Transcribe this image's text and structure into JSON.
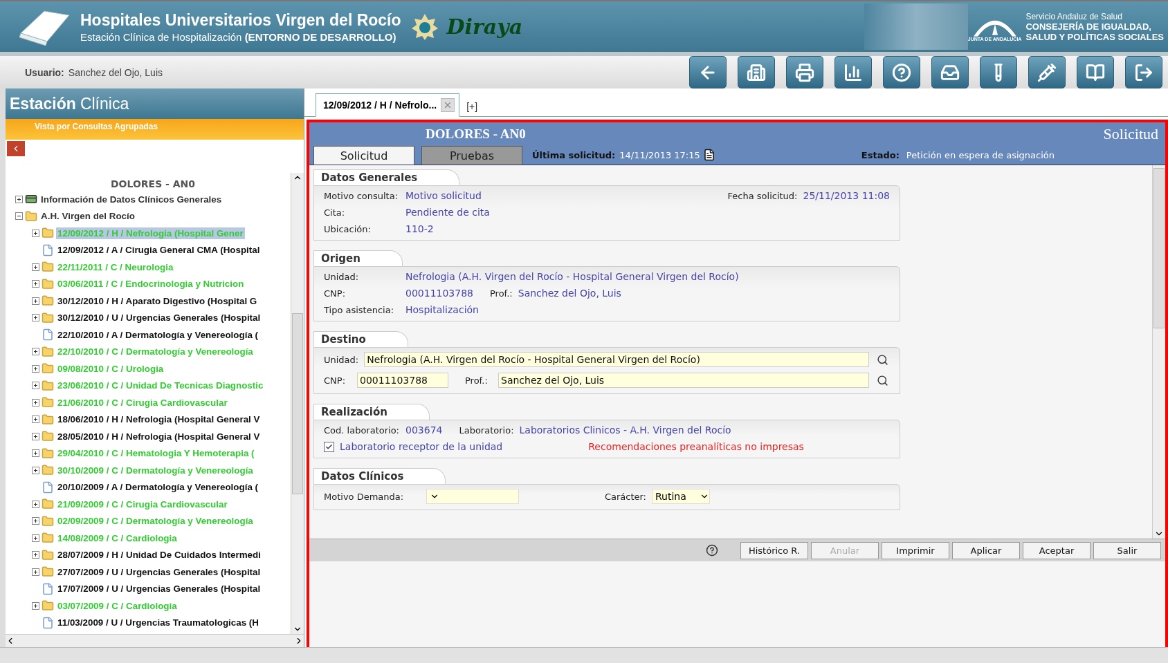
{
  "header": {
    "title": "Hospitales Universitarios Virgen del Rocío",
    "subtitle": "Estación Clínica de Hospitalización **(ENTORNO DE DESARROLLO)**",
    "brand": "Diraya",
    "agency_small": "JUNTA DE ANDALUCIA",
    "agency_service": "Servicio Andaluz de Salud",
    "agency_lines": [
      "CONSEJERÍA DE IGUALDAD,",
      "SALUD Y POLÍTICAS SOCIALES"
    ]
  },
  "user": {
    "label": "Usuario:",
    "name": "Sanchez del Ojo, Luis"
  },
  "toolbar": [
    {
      "kind": "back"
    },
    {
      "kind": "record"
    },
    {
      "kind": "scanner"
    },
    {
      "kind": "chart"
    },
    {
      "kind": "help"
    },
    {
      "kind": "tray"
    },
    {
      "kind": "tube"
    },
    {
      "kind": "syringe"
    },
    {
      "kind": "book"
    },
    {
      "kind": "exit"
    }
  ],
  "sidebar": {
    "title_bold": "Estación",
    "title_rest": "Clínica",
    "view": "Vista por Consultas Agrupadas",
    "patient": "DOLORES - AN0",
    "tree": [
      {
        "label": "Información de Datos Clínicos Generales",
        "kind": "record",
        "expanded": false,
        "color": "#333333",
        "selected": false
      },
      {
        "label": "A.H. Virgen del Rocío",
        "kind": "folder",
        "expanded": true,
        "color": "#333333",
        "selected": false,
        "children": [
          {
            "label": "12/09/2012 / H / Nefrologia (Hospital Gener",
            "kind": "folder",
            "expanded": false,
            "color": "#33cc33",
            "selected": true
          },
          {
            "label": "12/09/2012 / A / Cirugia General CMA (Hospital",
            "kind": "document",
            "color": "#111111",
            "selected": false
          },
          {
            "label": "22/11/2011 / C / Neurologia",
            "kind": "folder",
            "expanded": false,
            "color": "#33cc33",
            "selected": false
          },
          {
            "label": "03/06/2011 / C / Endocrinologia y Nutricion",
            "kind": "folder",
            "expanded": false,
            "color": "#33cc33",
            "selected": false
          },
          {
            "label": "30/12/2010 / H / Aparato Digestivo (Hospital G",
            "kind": "folder",
            "expanded": false,
            "color": "#111111",
            "selected": false
          },
          {
            "label": "30/12/2010 / U / Urgencias Generales (Hospital",
            "kind": "folder",
            "expanded": false,
            "color": "#111111",
            "selected": false
          },
          {
            "label": "22/10/2010 / A / Dermatología y Venereología (",
            "kind": "document",
            "color": "#111111",
            "selected": false
          },
          {
            "label": "22/10/2010 / C / Dermatología y Venereología",
            "kind": "folder",
            "expanded": false,
            "color": "#33cc33",
            "selected": false
          },
          {
            "label": "09/08/2010 / C / Urologia",
            "kind": "folder",
            "expanded": false,
            "color": "#33cc33",
            "selected": false
          },
          {
            "label": "23/06/2010 / C / Unidad De Tecnicas Diagnostic",
            "kind": "folder",
            "expanded": false,
            "color": "#33cc33",
            "selected": false
          },
          {
            "label": "21/06/2010 / C / Cirugia Cardiovascular",
            "kind": "folder",
            "expanded": false,
            "color": "#33cc33",
            "selected": false
          },
          {
            "label": "18/06/2010 / H / Nefrologia (Hospital General V",
            "kind": "folder",
            "expanded": false,
            "color": "#111111",
            "selected": false
          },
          {
            "label": "28/05/2010 / H / Nefrologia (Hospital General V",
            "kind": "folder",
            "expanded": false,
            "color": "#111111",
            "selected": false
          },
          {
            "label": "29/04/2010 / C / Hematologia Y Hemoterapia (",
            "kind": "folder",
            "expanded": false,
            "color": "#33cc33",
            "selected": false
          },
          {
            "label": "30/10/2009 / C / Dermatología y Venereología",
            "kind": "folder",
            "expanded": false,
            "color": "#33cc33",
            "selected": false
          },
          {
            "label": "20/10/2009 / A / Dermatología y Venereología (",
            "kind": "document",
            "color": "#111111",
            "selected": false
          },
          {
            "label": "21/09/2009 / C / Cirugia Cardiovascular",
            "kind": "folder",
            "expanded": false,
            "color": "#33cc33",
            "selected": false
          },
          {
            "label": "02/09/2009 / C / Dermatología y Venereología",
            "kind": "folder",
            "expanded": false,
            "color": "#33cc33",
            "selected": false
          },
          {
            "label": "14/08/2009 / C / Cardiologia",
            "kind": "folder",
            "expanded": false,
            "color": "#33cc33",
            "selected": false
          },
          {
            "label": "28/07/2009 / H / Unidad De Cuidados Intermedi",
            "kind": "folder",
            "expanded": false,
            "color": "#111111",
            "selected": false
          },
          {
            "label": "27/07/2009 / U / Urgencias Generales (Hospital",
            "kind": "folder",
            "expanded": false,
            "color": "#111111",
            "selected": false
          },
          {
            "label": "17/07/2009 / U / Urgencias Generales (Hospital",
            "kind": "document",
            "color": "#111111",
            "selected": false
          },
          {
            "label": "03/07/2009 / C / Cardiologia",
            "kind": "folder",
            "expanded": false,
            "color": "#33cc33",
            "selected": false
          },
          {
            "label": "11/03/2009 / U / Urgencias Traumatologicas (H",
            "kind": "document",
            "color": "#111111",
            "selected": false
          }
        ]
      }
    ]
  },
  "doc_tabs": {
    "tabs": [
      {
        "label": "12/09/2012 / H / Nefrolo...",
        "selected": true
      }
    ],
    "add": "[+]"
  },
  "form": {
    "patient": "DOLORES - AN0",
    "title": "Solicitud",
    "tabs": [
      {
        "label": "Solicitud",
        "selected": true
      },
      {
        "label": "Pruebas",
        "selected": false
      }
    ],
    "last_label": "Última solicitud:",
    "last_value": "14/11/2013 17:15",
    "state_label": "Estado:",
    "state_value": "Petición en espera de asignación",
    "sections": [
      {
        "title": "Datos Generales",
        "rows": [
          [
            {
              "kind": "text",
              "label": "Motivo consulta:",
              "value": "Motivo solicitud"
            },
            {
              "kind": "text",
              "label": "Fecha solicitud:",
              "value": "25/11/2013 11:08"
            }
          ],
          [
            {
              "kind": "text",
              "label": "Cita:",
              "value": "Pendiente de cita"
            }
          ],
          [
            {
              "kind": "text",
              "label": "Ubicación:",
              "value": "110-2"
            }
          ]
        ]
      },
      {
        "title": "Origen",
        "rows": [
          [
            {
              "kind": "text",
              "label": "Unidad:",
              "value": "Nefrologia (A.H. Virgen del Rocío - Hospital General Virgen del Rocío)"
            }
          ],
          [
            {
              "kind": "text",
              "label": "CNP:",
              "value": "00011103788"
            },
            {
              "kind": "text",
              "label": "Prof.:",
              "value": "Sanchez del Ojo, Luis"
            }
          ],
          [
            {
              "kind": "text",
              "label": "Tipo asistencia:",
              "value": "Hospitalización"
            }
          ]
        ]
      },
      {
        "title": "Destino",
        "rows": [
          [
            {
              "kind": "lookup",
              "label": "Unidad:",
              "value": "Nefrologia (A.H. Virgen del Rocío - Hospital General Virgen del Rocío)"
            }
          ],
          [
            {
              "kind": "input",
              "label": "CNP:",
              "value": "00011103788"
            },
            {
              "kind": "lookup",
              "label": "Prof.:",
              "value": "Sanchez del Ojo, Luis"
            }
          ]
        ]
      },
      {
        "title": "Realización",
        "rows": [
          [
            {
              "kind": "text",
              "label": "Cod. laboratorio:",
              "value": "003674"
            },
            {
              "kind": "text",
              "label": "Laboratorio:",
              "value": "Laboratorios Clinicos - A.H. Virgen del Rocío"
            }
          ],
          [
            {
              "kind": "checkbox",
              "value": "Laboratorio receptor de la unidad",
              "checked": true
            },
            {
              "kind": "alert",
              "value": "Recomendaciones preanalíticas no impresas"
            }
          ]
        ]
      },
      {
        "title": "Datos Clínicos",
        "rows": [
          [
            {
              "kind": "select",
              "label": "Motivo Demanda:"
            },
            {
              "kind": "select",
              "label": "Carácter:",
              "value": "Rutina"
            }
          ]
        ]
      }
    ],
    "buttons": [
      {
        "label": "Histórico R.",
        "disabled": false
      },
      {
        "label": "Anular",
        "disabled": true
      },
      {
        "label": "Imprimir",
        "disabled": false
      },
      {
        "label": "Aplicar",
        "disabled": false
      },
      {
        "label": "Aceptar",
        "disabled": false
      },
      {
        "label": "Salir",
        "disabled": false
      }
    ]
  }
}
